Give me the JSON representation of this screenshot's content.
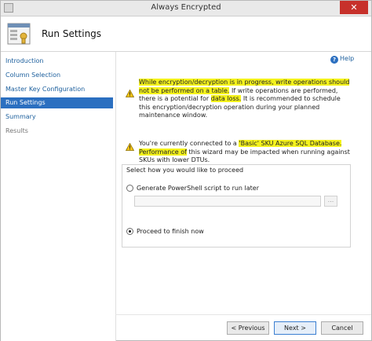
{
  "window": {
    "title": "Always Encrypted"
  },
  "header": {
    "title": "Run Settings",
    "icon": "wizard-icon"
  },
  "sidebar": {
    "items": [
      {
        "label": "Introduction",
        "state": "link"
      },
      {
        "label": "Column Selection",
        "state": "link"
      },
      {
        "label": "Master Key Configuration",
        "state": "link"
      },
      {
        "label": "Run Settings",
        "state": "active"
      },
      {
        "label": "Summary",
        "state": "link"
      },
      {
        "label": "Results",
        "state": "disabled"
      }
    ]
  },
  "help": {
    "label": "Help",
    "icon": "help-icon"
  },
  "warning1": {
    "highlight_a": "While encryption/decryption is in progress, write operations should not be performed on a table.",
    "normal_a": " If write operations are performed, there is a potential for ",
    "highlight_b": "data loss.",
    "normal_b": " It is recommended to schedule this encryption/decryption operation during your planned maintenance window."
  },
  "warning2": {
    "normal_a": "You're currently connected to a ",
    "highlight_a": "'Basic' SKU Azure SQL Database.  Performance of",
    "normal_b": " this wizard may be impacted when running against SKUs with lower DTUs."
  },
  "proceed": {
    "group_label": "Select how you would like to proceed",
    "option_script": "Generate PowerShell script to run later",
    "option_finish": "Proceed to finish now",
    "selected": "finish",
    "path_value": "",
    "browse_label": "..."
  },
  "footer": {
    "previous": "< Previous",
    "next": "Next >",
    "cancel": "Cancel"
  },
  "colors": {
    "accent": "#2b6fc0",
    "highlight": "#f4f21c",
    "close": "#c7312b"
  }
}
